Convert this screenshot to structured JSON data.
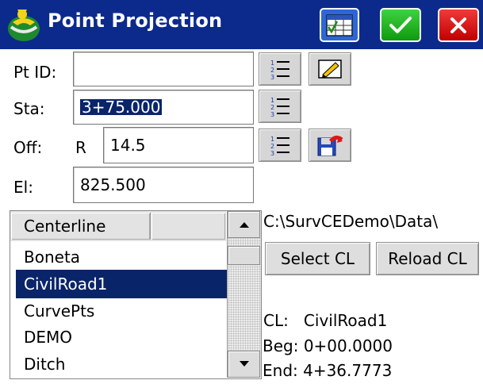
{
  "window": {
    "title": "Point Projection",
    "colors": {
      "title_bar": "#0b2a8c",
      "selection": "#0a246a",
      "ok": "#1fb31f",
      "close": "#d81010"
    }
  },
  "toolbar": {
    "grid_icon": "table-view-icon",
    "ok_icon": "checkmark-icon",
    "close_icon": "close-x-icon"
  },
  "form": {
    "pt_id": {
      "label": "Pt ID:",
      "value": ""
    },
    "sta": {
      "label": "Sta:",
      "value": "3+75.000"
    },
    "off": {
      "label": "Off:",
      "side": "R",
      "value": "14.5"
    },
    "el": {
      "label": "El:",
      "value": "825.500"
    }
  },
  "list": {
    "header": "Centerline",
    "items": [
      "Boneta",
      "CivilRoad1",
      "CurvePts",
      "DEMO",
      "Ditch"
    ],
    "selected": "CivilRoad1"
  },
  "path": "C:\\SurvCEDemo\\Data\\",
  "buttons": {
    "select_cl": "Select CL",
    "reload_cl": "Reload CL"
  },
  "info": {
    "cl": "CL:   CivilRoad1",
    "beg": "Beg: 0+00.0000",
    "end": "End: 4+36.7773"
  }
}
